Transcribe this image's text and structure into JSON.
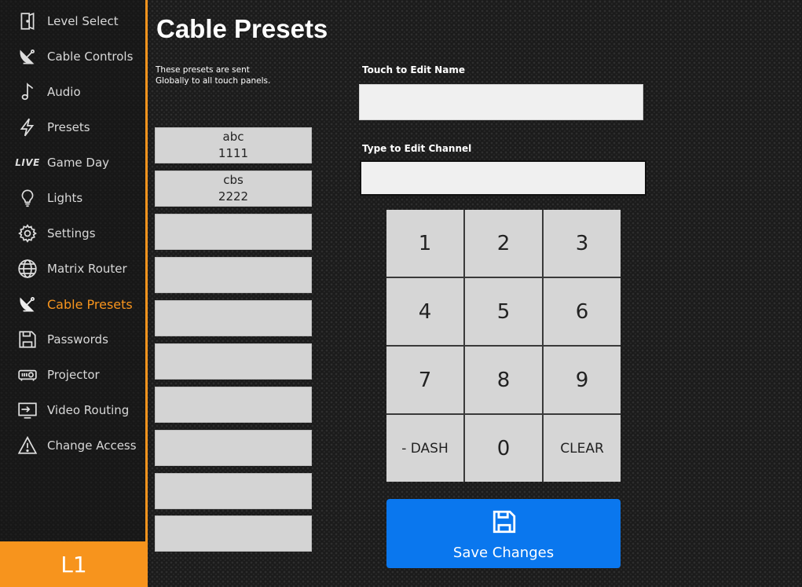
{
  "sidebar": {
    "items": [
      {
        "label": "Level Select",
        "icon": "door-icon"
      },
      {
        "label": "Cable Controls",
        "icon": "satellite-dish-icon"
      },
      {
        "label": "Audio",
        "icon": "music-note-icon"
      },
      {
        "label": "Presets",
        "icon": "lightning-icon"
      },
      {
        "label": "Game Day",
        "icon": "live-icon",
        "icon_text": "LIVE"
      },
      {
        "label": "Lights",
        "icon": "lightbulb-icon"
      },
      {
        "label": "Settings",
        "icon": "gear-icon"
      },
      {
        "label": "Matrix Router",
        "icon": "globe-icon"
      },
      {
        "label": "Cable Presets",
        "icon": "satellite-dish-icon",
        "active": true
      },
      {
        "label": "Passwords",
        "icon": "floppy-disk-icon"
      },
      {
        "label": "Projector",
        "icon": "projector-icon"
      },
      {
        "label": "Video Routing",
        "icon": "display-input-icon"
      },
      {
        "label": "Change Access",
        "icon": "warning-icon"
      }
    ],
    "level_badge": "L1"
  },
  "main": {
    "title": "Cable Presets",
    "note_line1": "These presets are sent",
    "note_line2": "Globally to all touch panels.",
    "presets": [
      {
        "name": "abc",
        "channel": "1111"
      },
      {
        "name": "cbs",
        "channel": "2222"
      },
      {
        "name": "",
        "channel": ""
      },
      {
        "name": "",
        "channel": ""
      },
      {
        "name": "",
        "channel": ""
      },
      {
        "name": "",
        "channel": ""
      },
      {
        "name": "",
        "channel": ""
      },
      {
        "name": "",
        "channel": ""
      },
      {
        "name": "",
        "channel": ""
      },
      {
        "name": "",
        "channel": ""
      }
    ],
    "name_field_label": "Touch to Edit Name",
    "name_field_value": "",
    "channel_field_label": "Type to Edit Channel",
    "channel_field_value": "",
    "keypad": [
      "1",
      "2",
      "3",
      "4",
      "5",
      "6",
      "7",
      "8",
      "9",
      "- DASH",
      "0",
      "CLEAR"
    ],
    "save_label": "Save Changes"
  },
  "colors": {
    "accent": "#f7941d",
    "save_button": "#0a77ee",
    "key_background": "#d6d6d6"
  }
}
